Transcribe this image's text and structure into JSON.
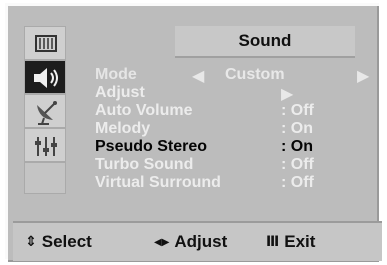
{
  "title": "Sound",
  "sidebar": {
    "items": [
      {
        "icon": "picture-icon",
        "active": false
      },
      {
        "icon": "speaker-icon",
        "active": true
      },
      {
        "icon": "satellite-dish-icon",
        "active": false
      },
      {
        "icon": "setup-sliders-icon",
        "active": false
      }
    ]
  },
  "menu": {
    "items": [
      {
        "label": "Mode",
        "value": "Custom",
        "left_arrow": "◀",
        "right_arrow": "▶"
      },
      {
        "label": "Adjust",
        "arrow": "▶"
      },
      {
        "label": "Auto Volume",
        "value": ": Off"
      },
      {
        "label": "Melody",
        "value": ": On"
      },
      {
        "label": "Pseudo Stereo",
        "value": ": On"
      },
      {
        "label": "Turbo Sound",
        "value": ": Off"
      },
      {
        "label": "Virtual Surround",
        "value": ": Off"
      }
    ]
  },
  "footer": {
    "select_icon": "⇕",
    "select_label": "Select",
    "adjust_icon": "◀▶",
    "adjust_label": "Adjust",
    "exit_icon": "Ⅲ",
    "exit_label": "Exit"
  }
}
